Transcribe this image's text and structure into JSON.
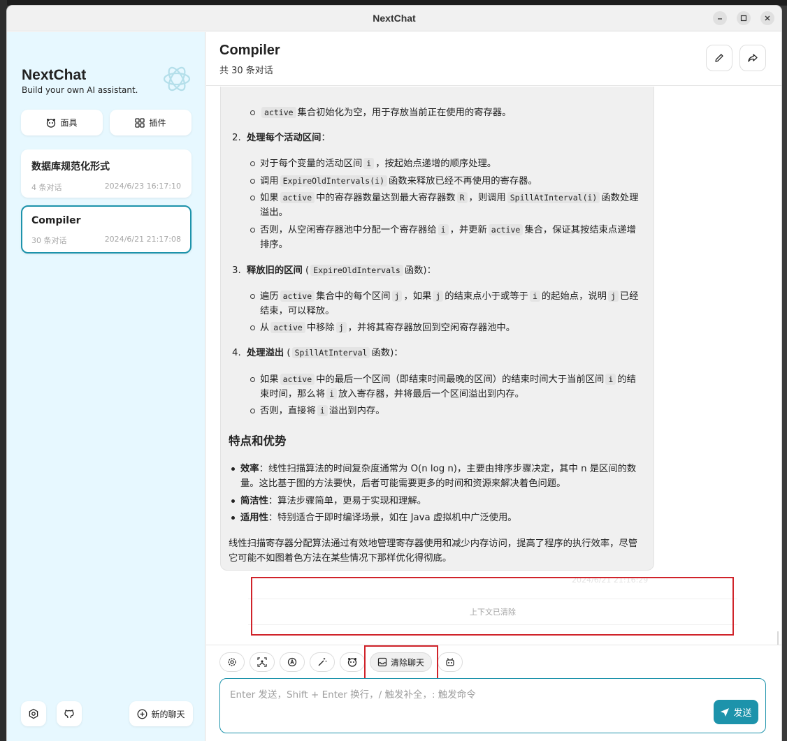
{
  "window": {
    "title": "NextChat"
  },
  "sidebar": {
    "title": "NextChat",
    "subtitle": "Build your own AI assistant.",
    "mask_label": "面具",
    "plugin_label": "插件",
    "chats": [
      {
        "title": "数据库规范化形式",
        "count": "4 条对话",
        "time": "2024/6/23 16:17:10"
      },
      {
        "title": "Compiler",
        "count": "30 条对话",
        "time": "2024/6/21 21:17:08"
      }
    ],
    "new_chat_label": "新的聊天"
  },
  "header": {
    "title": "Compiler",
    "subtitle": "共 30 条对话"
  },
  "message": {
    "b0": {
      "code": "active",
      "text": "集合初始化为空，用于存放当前正在使用的寄存器。"
    },
    "s2": {
      "num": "2.",
      "title": "处理每个活动区间",
      "colon": "："
    },
    "s2_items": {
      "a": {
        "t1": "对于每个变量的活动区间",
        "c1": "i",
        "t2": "，按起始点递增的顺序处理。"
      },
      "b": {
        "t1": "调用",
        "c1": "ExpireOldIntervals(i)",
        "t2": "函数来释放已经不再使用的寄存器。"
      },
      "c": {
        "t1": "如果",
        "c1": "active",
        "t2": "中的寄存器数量达到最大寄存器数",
        "c2": "R",
        "t3": "，则调用",
        "c3": "SpillAtInterval(i)",
        "t4": "函数处理溢出。"
      },
      "d": {
        "t1": "否则，从空闲寄存器池中分配一个寄存器给",
        "c1": "i",
        "t2": "，并更新",
        "c2": "active",
        "t3": "集合，保证其按结束点递增排序。"
      }
    },
    "s3": {
      "num": "3.",
      "title": "释放旧的区间",
      "paren_open": "(",
      "code": "ExpireOldIntervals",
      "suffix": "函数)："
    },
    "s3_items": {
      "a": {
        "t1": "遍历",
        "c1": "active",
        "t2": "集合中的每个区间",
        "c2": "j",
        "t3": "，如果",
        "c3": "j",
        "t4": "的结束点小于或等于",
        "c4": "i",
        "t5": "的起始点，说明",
        "c5": "j",
        "t6": "已经结束，可以释放。"
      },
      "b": {
        "t1": "从",
        "c1": "active",
        "t2": "中移除",
        "c2": "j",
        "t3": "，并将其寄存器放回到空闲寄存器池中。"
      }
    },
    "s4": {
      "num": "4.",
      "title": "处理溢出",
      "paren_open": "(",
      "code": "SpillAtInterval",
      "suffix": "函数)："
    },
    "s4_items": {
      "a": {
        "t1": "如果",
        "c1": "active",
        "t2": "中的最后一个区间（即结束时间最晚的区间）的结束时间大于当前区间",
        "c2": "i",
        "t3": "的结束时间，那么将",
        "c3": "i",
        "t4": "放入寄存器，并将最后一个区间溢出到内存。"
      },
      "b": {
        "t1": "否则，直接将",
        "c1": "i",
        "t2": "溢出到内存。"
      }
    },
    "features_heading": "特点和优势",
    "features": [
      {
        "label": "效率",
        "text": "：线性扫描算法的时间复杂度通常为 O(n log n)，主要由排序步骤决定，其中 n 是区间的数量。这比基于图的方法要快，后者可能需要更多的时间和资源来解决着色问题。"
      },
      {
        "label": "简洁性",
        "text": "：算法步骤简单，更易于实现和理解。"
      },
      {
        "label": "适用性",
        "text": "：特别适合于即时编译场景，如在 Java 虚拟机中广泛使用。"
      }
    ],
    "summary": "线性扫描寄存器分配算法通过有效地管理寄存器使用和减少内存访问，提高了程序的执行效率，尽管它可能不如图着色方法在某些情况下那样优化得彻底。",
    "date": "2024/6/21 21:16:29"
  },
  "context_cleared": "上下文已清除",
  "input": {
    "clear_label": "清除聊天",
    "placeholder": "Enter 发送，Shift + Enter 换行，/ 触发补全，: 触发命令",
    "send_label": "发送"
  },
  "accent_color": "#1d93ab",
  "highlight_color": "#d0232a"
}
